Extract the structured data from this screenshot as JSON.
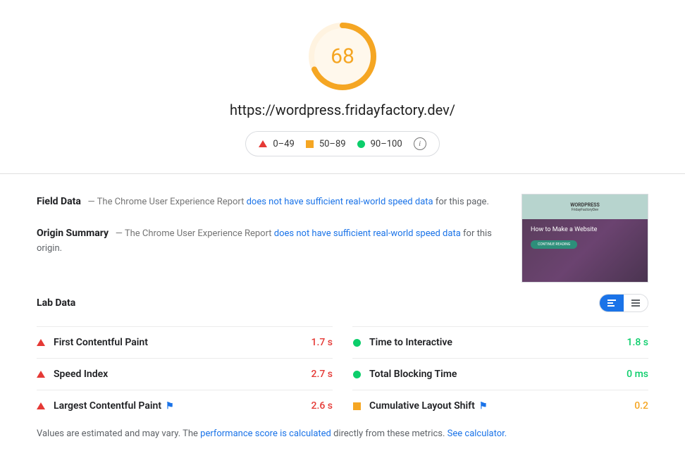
{
  "score": 68,
  "url": "https://wordpress.fridayfactory.dev/",
  "legend": {
    "poor": "0–49",
    "medium": "50–89",
    "good": "90–100"
  },
  "field_data": {
    "label": "Field Data",
    "pre": "— The Chrome User Experience Report ",
    "link": "does not have sufficient real-world speed data",
    "post": " for this page."
  },
  "origin_summary": {
    "label": "Origin Summary",
    "pre": "— The Chrome User Experience Report ",
    "link": "does not have sufficient real-world speed data",
    "post": " for this origin."
  },
  "thumbnail": {
    "site_name": "WORDPRESS",
    "tagline": "FridayFactoryDev",
    "heading": "How to Make a Website",
    "button": "CONTINUE READING"
  },
  "lab": {
    "title": "Lab Data",
    "metrics": [
      {
        "name": "First Contentful Paint",
        "value": "1.7 s",
        "status": "red",
        "flag": false
      },
      {
        "name": "Time to Interactive",
        "value": "1.8 s",
        "status": "green",
        "flag": false
      },
      {
        "name": "Speed Index",
        "value": "2.7 s",
        "status": "red",
        "flag": false
      },
      {
        "name": "Total Blocking Time",
        "value": "0 ms",
        "status": "green",
        "flag": false
      },
      {
        "name": "Largest Contentful Paint",
        "value": "2.6 s",
        "status": "red",
        "flag": true
      },
      {
        "name": "Cumulative Layout Shift",
        "value": "0.2",
        "status": "orange",
        "flag": true
      }
    ]
  },
  "footer": {
    "pre": "Values are estimated and may vary. The ",
    "link1": "performance score is calculated",
    "mid": " directly from these metrics. ",
    "link2": "See calculator."
  }
}
